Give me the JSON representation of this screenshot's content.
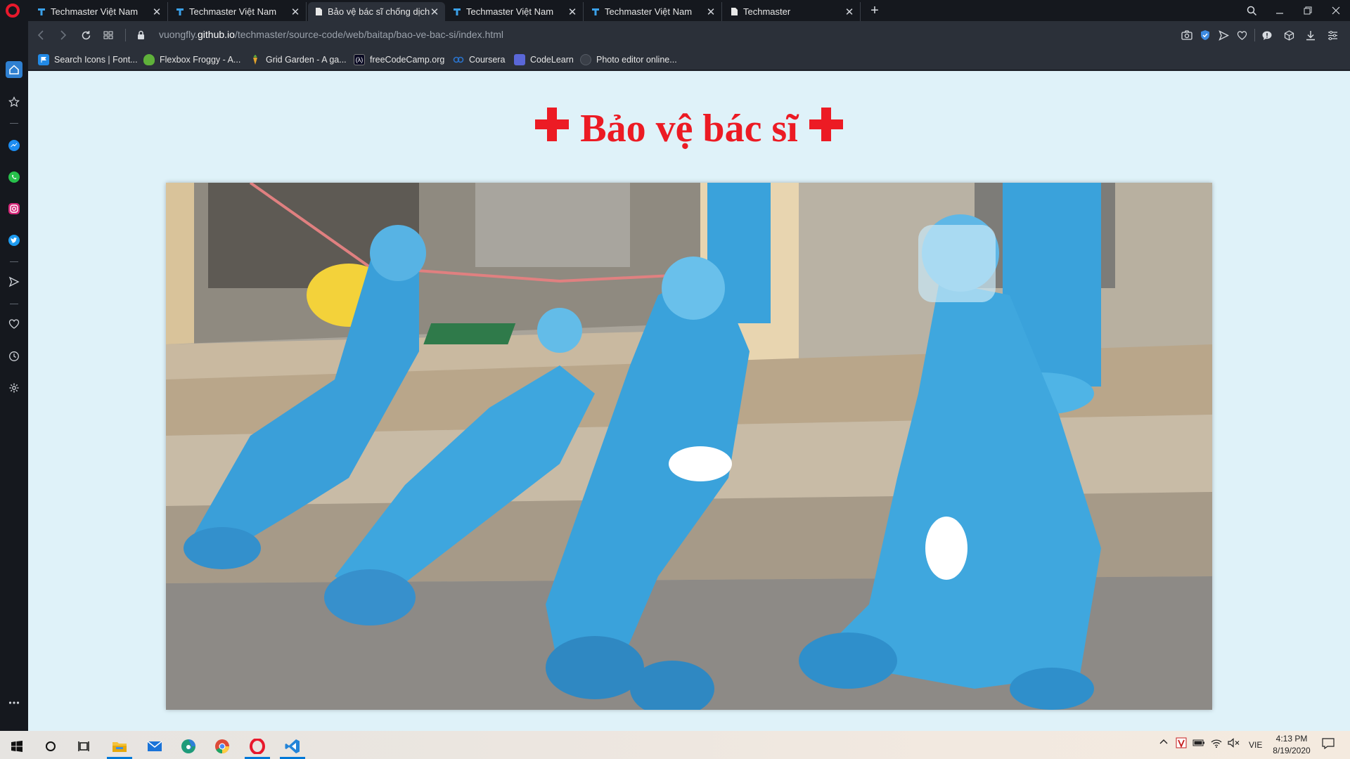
{
  "browser": {
    "tabs": [
      {
        "title": "Techmaster Việt Nam",
        "favicon": "techmaster-favicon",
        "active": false
      },
      {
        "title": "Techmaster Việt Nam",
        "favicon": "techmaster-favicon",
        "active": false
      },
      {
        "title": "Bảo vệ bác sĩ chống dịch C",
        "favicon": "document-favicon",
        "active": true
      },
      {
        "title": "Techmaster Việt Nam",
        "favicon": "techmaster-favicon",
        "active": false
      },
      {
        "title": "Techmaster Việt Nam",
        "favicon": "techmaster-favicon",
        "active": false
      },
      {
        "title": "Techmaster",
        "favicon": "document-favicon",
        "active": false
      }
    ],
    "close_glyph": "✕",
    "new_tab_glyph": "+",
    "address": {
      "prefix": "vuongfly.",
      "domain": "github.io",
      "path": "/techmaster/source-code/web/baitap/bao-ve-bac-si/index.html"
    },
    "bookmarks": [
      {
        "label": "Search Icons | Font...",
        "icon": "font-awesome-flag-icon",
        "color": "#228ae6"
      },
      {
        "label": "Flexbox Froggy - A...",
        "icon": "frog-icon",
        "color": "#5fb13a"
      },
      {
        "label": "Grid Garden - A ga...",
        "icon": "carrot-icon",
        "color": "#e3a32b"
      },
      {
        "label": "freeCodeCamp.org",
        "icon": "freecodecamp-icon",
        "color": "#0a0a23"
      },
      {
        "label": "Coursera",
        "icon": "coursera-icon",
        "color": "#2a73cc"
      },
      {
        "label": "CodeLearn",
        "icon": "codelearn-icon",
        "color": "#5a67d8"
      },
      {
        "label": "Photo editor online...",
        "icon": "photo-editor-icon",
        "color": "#555b64"
      }
    ]
  },
  "page": {
    "heading": "Bảo vệ bác sĩ",
    "cross_color": "#ec1b24",
    "background": "#dff2f9",
    "photo_alt": "photo-healthcare-workers-resting"
  },
  "taskbar": {
    "language": "VIE",
    "time": "4:13 PM",
    "date": "8/19/2020"
  }
}
